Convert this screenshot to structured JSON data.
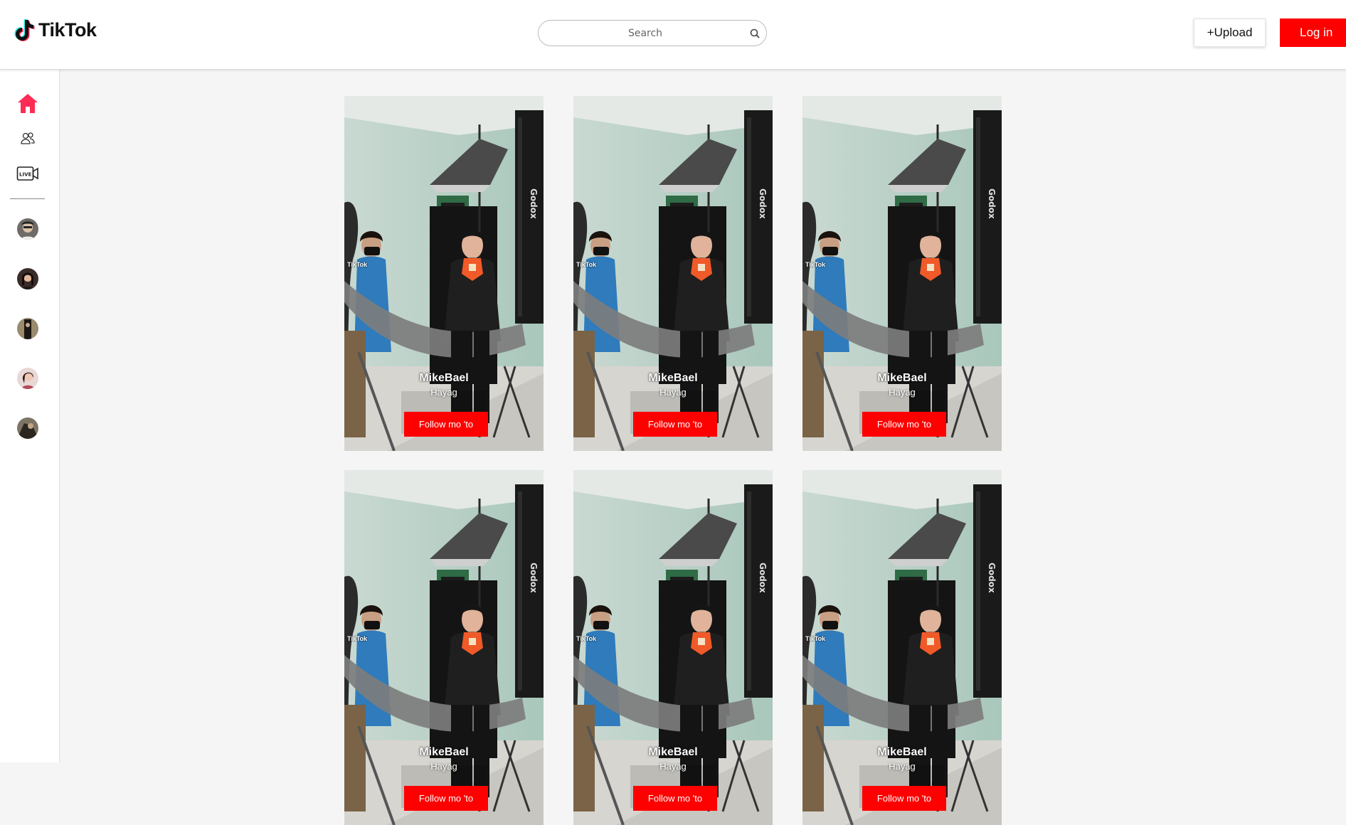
{
  "header": {
    "logo_text": "TikTok",
    "search_placeholder": "Search",
    "upload_label": "+Upload",
    "login_label": "Log in",
    "brand_color": "#fe0000"
  },
  "sidebar": {
    "nav": [
      {
        "name": "home-icon",
        "active": true,
        "color": "#fe2c55"
      },
      {
        "name": "following-icon",
        "active": false
      },
      {
        "name": "live-icon",
        "active": false,
        "text": "LIVE"
      }
    ],
    "avatars": [
      "avatar-1",
      "avatar-2",
      "avatar-3",
      "avatar-4",
      "avatar-5"
    ]
  },
  "feed": {
    "cards": [
      {
        "username": "MikeBael",
        "subtitle": "Hayag",
        "button_label": "Follow mo 'to",
        "watermark": "TikTok"
      },
      {
        "username": "MikeBael",
        "subtitle": "Hayag",
        "button_label": "Follow mo 'to",
        "watermark": "TikTok"
      },
      {
        "username": "MikeBael",
        "subtitle": "Hayag",
        "button_label": "Follow mo 'to",
        "watermark": "TikTok"
      },
      {
        "username": "MikeBael",
        "subtitle": "Hayag",
        "button_label": "Follow mo 'to",
        "watermark": "TikTok"
      },
      {
        "username": "MikeBael",
        "subtitle": "Hayag",
        "button_label": "Follow mo 'to",
        "watermark": "TikTok"
      },
      {
        "username": "MikeBael",
        "subtitle": "Hayag",
        "button_label": "Follow mo 'to",
        "watermark": "TikTok"
      }
    ]
  }
}
